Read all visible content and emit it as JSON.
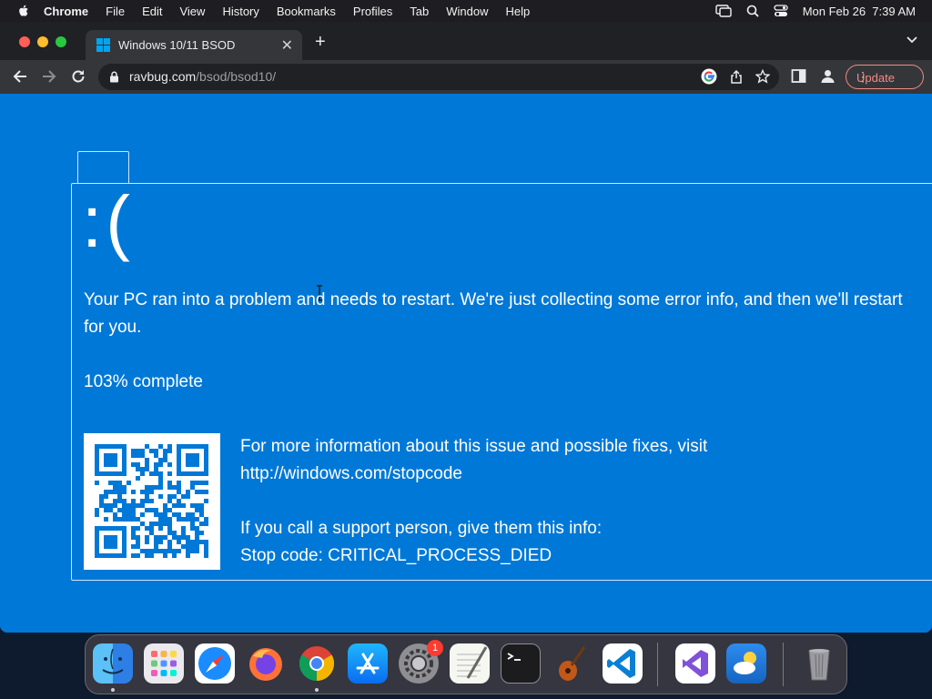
{
  "menubar": {
    "app_name": "Chrome",
    "items": [
      "File",
      "Edit",
      "View",
      "History",
      "Bookmarks",
      "Profiles",
      "Tab",
      "Window",
      "Help"
    ],
    "clock": "Mon Feb 26  7:39 AM"
  },
  "browser": {
    "tab_title": "Windows 10/11 BSOD",
    "url_host": "ravbug.com",
    "url_path": "/bsod/bsod10/",
    "update_label": "Update",
    "accent": "#f28b82"
  },
  "bsod": {
    "face": ":(",
    "message": "Your PC ran into a problem and needs to restart. We're just collecting some error info, and then we'll restart for you.",
    "progress": "103% complete",
    "info_line1": "For more information about this issue and possible fixes, visit",
    "info_link": "http://windows.com/stopcode",
    "support_line": "If you call a support person, give them this info:",
    "stop_code": "Stop code: CRITICAL_PROCESS_DIED",
    "background_color": "#0078d7"
  },
  "dock": {
    "apps": [
      "finder",
      "launchpad",
      "safari",
      "firefox",
      "chrome",
      "app-store",
      "system-settings",
      "textedit",
      "terminal",
      "garageband",
      "vscode",
      "visual-studio",
      "weather",
      "trash"
    ],
    "settings_badge": "1"
  }
}
